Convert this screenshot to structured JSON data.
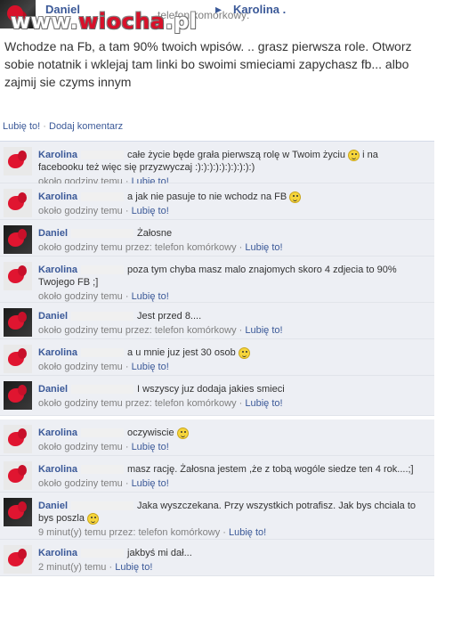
{
  "watermark": {
    "prefix": "www.",
    "brand": "wiocha",
    "suffix": ".pl"
  },
  "top": {
    "author": "Daniel",
    "source": "telefon komórkowy:",
    "arrow": "▸",
    "recipient": "Karolina ."
  },
  "post": {
    "text": "Wchodze na Fb, a tam 90% twoich wpisów. .. grasz pierwsza role. Otworz sobie notatnik i wklejaj tam linki bo swoimi smieciami zapychasz fb... albo zajmij sie czyms innym",
    "like": "Lubię to!",
    "comment": "Dodaj komentarz"
  },
  "comments": [
    {
      "name": "Karolina",
      "text": "całe życie będe grała pierwszą rolę w Twoim życiu",
      "text2": "i na facebooku też więc się przyzwyczaj :):):):):):):):):):)",
      "smile": true,
      "time": "około godziny temu",
      "via": "",
      "like": "Lubię to!",
      "dark": false
    },
    {
      "name": "Karolina",
      "text": "a jak nie pasuje to nie wchodz na FB",
      "text2": "",
      "smile": true,
      "time": "około godziny temu",
      "via": "",
      "like": "Lubię to!",
      "dark": false
    },
    {
      "name": "Daniel",
      "text": "Żałosne",
      "text2": "",
      "smile": false,
      "time": "około godziny temu przez:",
      "via": "telefon komórkowy",
      "like": "Lubię to!",
      "dark": true
    },
    {
      "name": "Karolina",
      "text": "poza tym chyba masz malo znajomych skoro 4 zdjecia to 90% Twojego FB ;]",
      "text2": "",
      "smile": false,
      "time": "około godziny temu",
      "via": "",
      "like": "Lubię to!",
      "dark": false
    },
    {
      "name": "Daniel",
      "text": "Jest przed 8....",
      "text2": "",
      "smile": false,
      "time": "około godziny temu przez:",
      "via": "telefon komórkowy",
      "like": "Lubię to!",
      "dark": true
    },
    {
      "name": "Karolina",
      "text": "a u mnie juz jest 30 osob",
      "text2": "",
      "smile": true,
      "time": "około godziny temu",
      "via": "",
      "like": "Lubię to!",
      "dark": false
    },
    {
      "name": "Daniel",
      "text": "I wszyscy juz dodaja jakies smieci",
      "text2": "",
      "smile": false,
      "time": "około godziny temu przez:",
      "via": "telefon komórkowy",
      "like": "Lubię to!",
      "dark": true
    },
    {
      "name": "Karolina",
      "text": "oczywiscie",
      "text2": "",
      "smile": true,
      "time": "około godziny temu",
      "via": "",
      "like": "Lubię to!",
      "dark": false
    },
    {
      "name": "Karolina",
      "text": "masz rację. Żałosna jestem ,że z tobą wogóle siedze ten 4 rok....;]",
      "text2": "",
      "smile": false,
      "time": "około godziny temu",
      "via": "",
      "like": "Lubię to!",
      "dark": false
    },
    {
      "name": "Daniel",
      "text": "Jaka wyszczekana. Przy wszystkich potrafisz. Jak bys chciala to bys poszla",
      "text2": "",
      "smile": true,
      "time": "9 minut(y) temu przez:",
      "via": "telefon komórkowy",
      "like": "Lubię to!",
      "dark": true
    },
    {
      "name": "Karolina",
      "text": "jakbyś mi dał...",
      "text2": "",
      "smile": false,
      "time": "2 minut(y) temu",
      "via": "",
      "like": "Lubię to!",
      "dark": false
    }
  ]
}
